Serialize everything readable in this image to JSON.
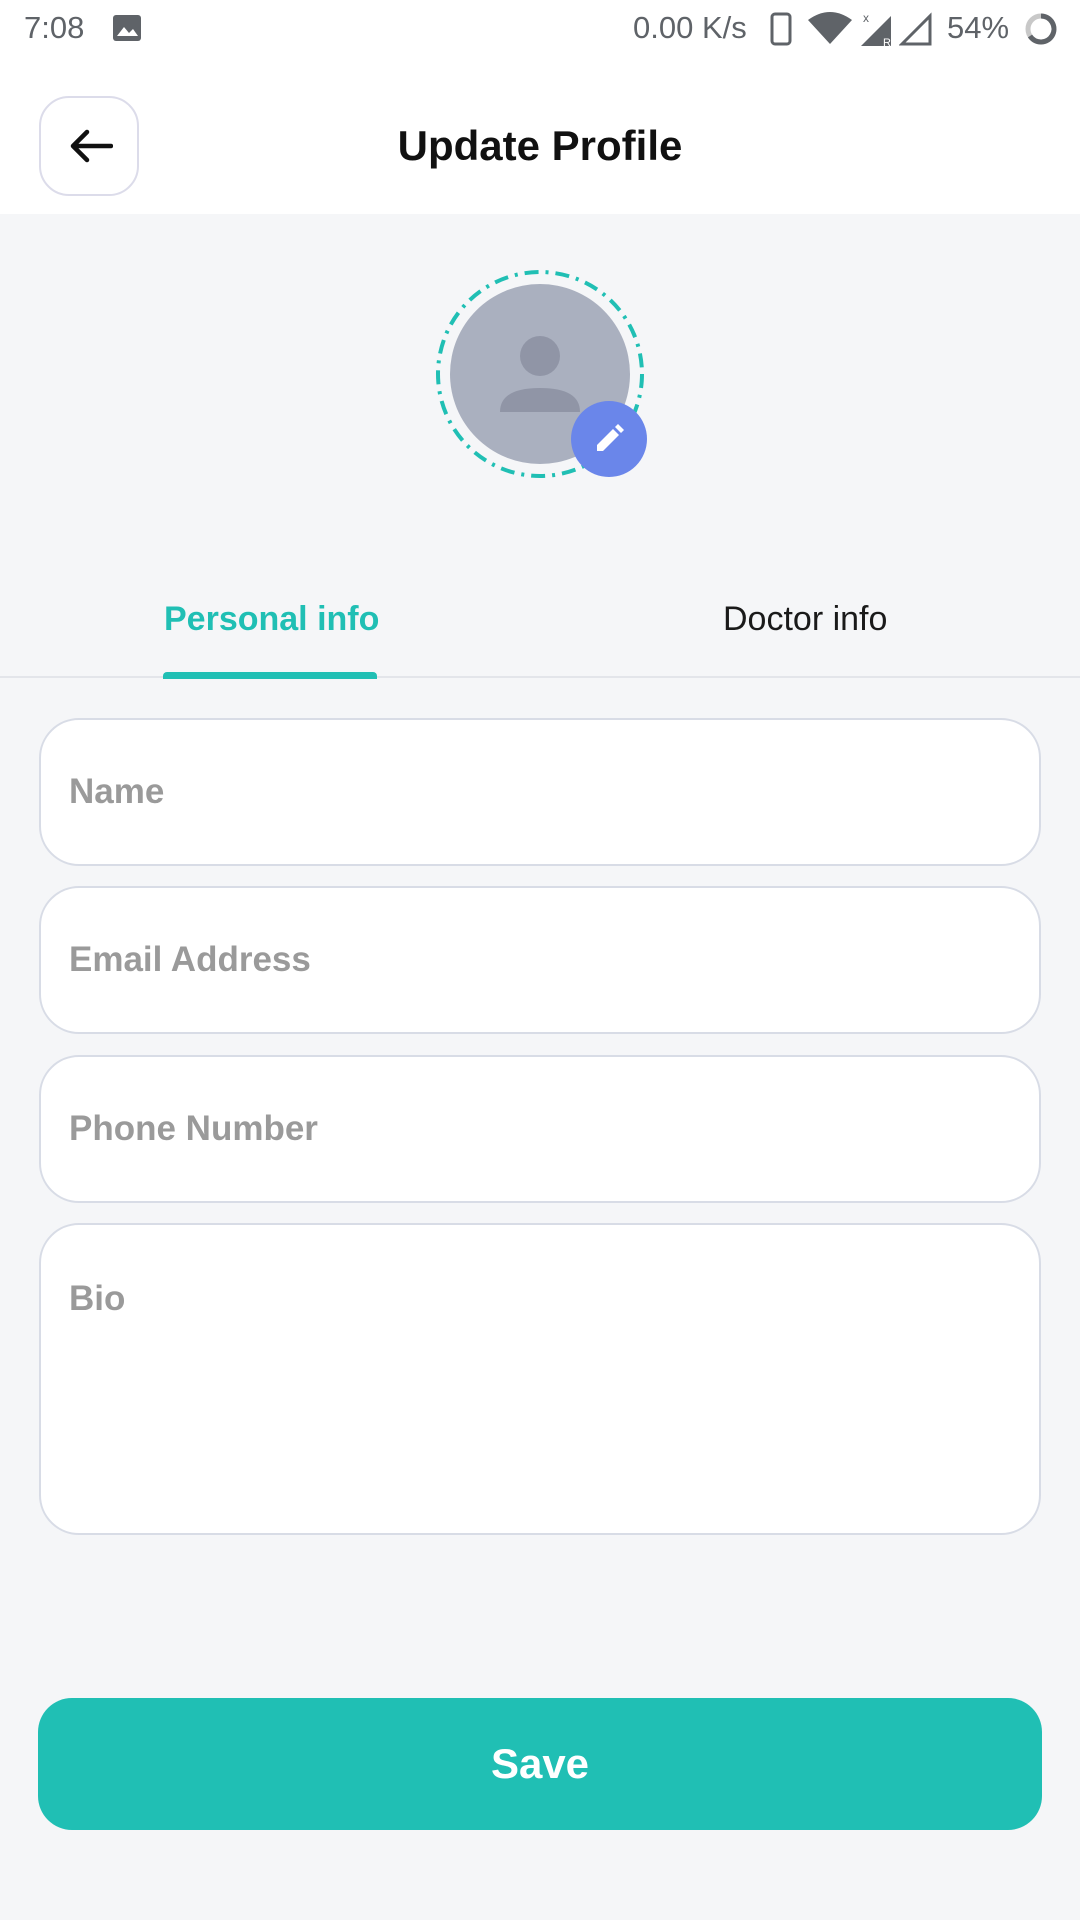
{
  "status_bar": {
    "time": "7:08",
    "net_speed": "0.00 K/s",
    "battery": "54%",
    "icons": [
      "image-icon",
      "phone-icon",
      "wifi-icon",
      "signal-roaming-icon",
      "signal-icon",
      "battery-icon"
    ]
  },
  "header": {
    "title": "Update Profile",
    "back_icon": "arrow-left-icon"
  },
  "avatar": {
    "placeholder_icon": "person-icon",
    "edit_icon": "pencil-icon"
  },
  "tabs": [
    {
      "label": "Personal info",
      "active": true
    },
    {
      "label": "Doctor info",
      "active": false
    }
  ],
  "form": {
    "name_placeholder": "Name",
    "email_placeholder": "Email Address",
    "phone_placeholder": "Phone Number",
    "bio_placeholder": "Bio"
  },
  "save_label": "Save",
  "colors": {
    "accent": "#20BFB4",
    "edit_button": "#6A86EA",
    "background": "#F5F6F8",
    "avatar": "#AAB0BF"
  }
}
